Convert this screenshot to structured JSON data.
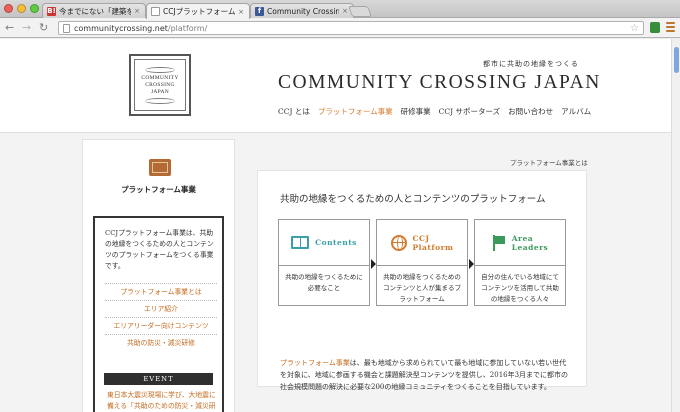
{
  "browser": {
    "tabs": [
      {
        "icon_text": "B!",
        "title": "今までにない「建築を活」",
        "close": "×",
        "active": false
      },
      {
        "icon_text": "",
        "title": "CCJプラットフォーム | Com",
        "close": "×",
        "active": true
      },
      {
        "icon_text": "f",
        "title": "Community Crossing Japa",
        "close": "×",
        "active": false
      }
    ],
    "url_host": "communitycrossing.net",
    "url_path": "/platform/",
    "icons": {
      "back": "back-arrow-icon",
      "forward": "forward-arrow-icon",
      "reload": "reload-icon",
      "bookmark": "star-icon",
      "menu": "wrench-icon"
    }
  },
  "site": {
    "logo_lines": [
      "COMMUNITY",
      "CROSSING",
      "JAPAN"
    ],
    "tagline": "都市に共助の地縁をつくる",
    "title": "COMMUNITY CROSSING JAPAN",
    "nav": [
      "CCJ とは",
      "プラットフォーム事業",
      "研修事業",
      "CCJ サポーターズ",
      "お問い合わせ",
      "アルバム"
    ],
    "nav_current_index": 1
  },
  "sidebar": {
    "heading": "プラットフォーム事業",
    "description": "CCJプラットフォーム事業は、共助の地縁をつくるための人とコンテンツのプラットフォームをつくる事業です。",
    "links": [
      "プラットフォーム事業とは",
      "エリア紹介",
      "エリアリーダー向けコンテンツ",
      "共助の防災・減災研修"
    ],
    "event_label": "EVENT",
    "event_link": "東日本大震災現場に学び、大地震に備える「共助のための防災・減災研修事業開催」"
  },
  "main": {
    "breadcrumb": "プラットフォーム事業とは",
    "card_title": "共助の地縁をつくるための人とコンテンツのプラットフォーム",
    "columns": [
      {
        "name": "Contents",
        "icon": "book-icon",
        "text": "共助の地縁をつくるために必要なこと"
      },
      {
        "name_line1": "CCJ",
        "name_line2": "Platform",
        "icon": "globe-icon",
        "text": "共助の地縁をつくるためのコンテンツと人が集まるプラットフォーム"
      },
      {
        "name_line1": "Area",
        "name_line2": "Leaders",
        "icon": "flag-icon",
        "text": "自分の住んでいる地域にてコンテンツを活用して共助の地縁をつくる人々"
      }
    ],
    "body_highlight": "プラットフォーム事業",
    "body_text": "は、最も地域から求められていて最も地域に参加していない若い世代を対象に、地域に参画する機会と課題解決型コンテンツを提供し、2016年3月までに都市の社会規模問題の解決に必要な200の地縁コミュニティをつくることを目指しています。"
  },
  "colors": {
    "accent": "#d47a2c",
    "teal": "#3aa0a8",
    "green": "#3a9a5a",
    "link": "#c66a1e"
  }
}
